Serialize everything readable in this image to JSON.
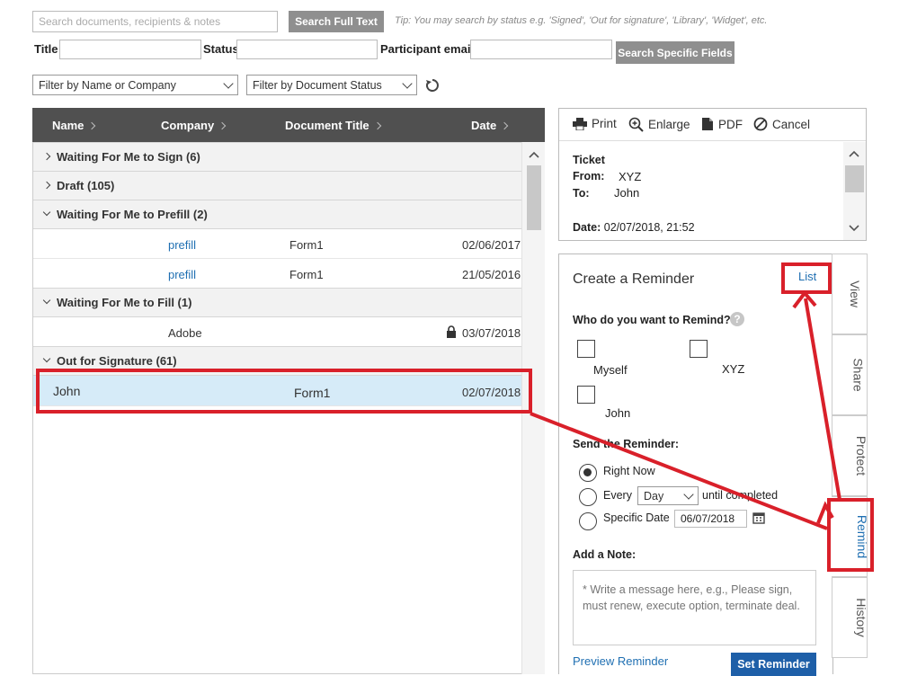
{
  "search": {
    "placeholder": "Search documents, recipients & notes",
    "full_text_button": "Search Full Text",
    "tip": "Tip: You may search by status e.g. 'Signed', 'Out for signature', 'Library', 'Widget', etc."
  },
  "fields": {
    "title_label": "Title",
    "status_label": "Status",
    "participant_label": "Participant email",
    "specific_button": "Search Specific Fields"
  },
  "filters": {
    "name_company": "Filter by Name or Company",
    "doc_status": "Filter by Document Status"
  },
  "table": {
    "headers": [
      "Name",
      "Company",
      "Document Title",
      "Date"
    ],
    "groups": [
      {
        "label": "Waiting For Me to Sign (6)",
        "expanded": false
      },
      {
        "label": "Draft (105)",
        "expanded": false
      },
      {
        "label": "Waiting For Me to Prefill (2)",
        "expanded": true
      },
      {
        "label": "Waiting For Me to Fill (1)",
        "expanded": true
      },
      {
        "label": "Out for Signature (61)",
        "expanded": true
      }
    ],
    "prefill_rows": [
      {
        "company": "prefill",
        "title": "Form1",
        "date": "02/06/2017"
      },
      {
        "company": "prefill",
        "title": "Form1",
        "date": "21/05/2016"
      }
    ],
    "fill_rows": [
      {
        "company": "Adobe",
        "date": "03/07/2018"
      }
    ],
    "signature_rows": [
      {
        "name": "John",
        "title": "Form1",
        "date": "02/07/2018"
      }
    ]
  },
  "toolbar": {
    "print": "Print",
    "enlarge": "Enlarge",
    "pdf": "PDF",
    "cancel": "Cancel"
  },
  "preview": {
    "title": "Ticket",
    "from_label": "From:",
    "from_value": "XYZ",
    "to_label": "To:",
    "to_value": "John",
    "date_label": "Date:",
    "date_value": "02/07/2018, 21:52"
  },
  "reminder": {
    "heading": "Create a Reminder",
    "list_link": "List",
    "who_label": "Who do you want to Remind?",
    "recipients": [
      "Myself",
      "XYZ",
      "John"
    ],
    "send_label": "Send the Reminder:",
    "right_now": "Right Now",
    "every": "Every",
    "every_value": "Day",
    "until_completed": "until completed",
    "specific_date": "Specific Date",
    "specific_date_value": "06/07/2018",
    "note_label": "Add a Note:",
    "note_placeholder": "* Write a message here, e.g., Please sign, must renew, execute option, terminate deal.",
    "preview_link": "Preview Reminder",
    "set_button": "Set Reminder"
  },
  "side_tabs": [
    "View",
    "Share",
    "Protect",
    "Remind",
    "History"
  ],
  "colors": {
    "annotation_red": "#d9202a",
    "link_blue": "#1f6fb2",
    "header_dark": "#505050",
    "selected_row": "#d6ebf8",
    "primary_button": "#1e5fa8"
  }
}
